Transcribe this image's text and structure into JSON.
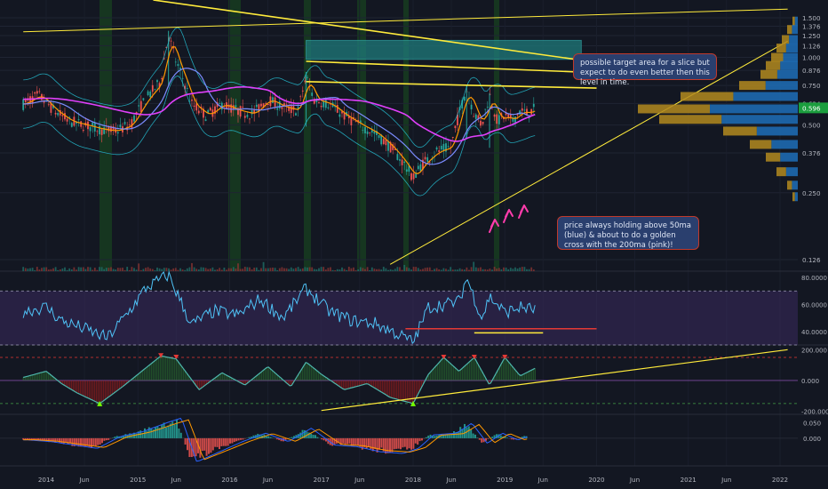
{
  "annotations": {
    "target": "possible target area for a slice but expect to do even better then this level in time.",
    "ma": "price always holding above 50ma (blue) & about to do a golden cross with the 200ma (pink)!"
  },
  "colors": {
    "background": "#131722",
    "candle_up": "#26a69a",
    "candle_down": "#ef5350",
    "ma50": "#7b8cff",
    "ma200": "#e040fb",
    "ema": "#ff9800",
    "bollinger": "#26c6da",
    "trendline": "#ffeb3b",
    "rsi": "#4fc3f7",
    "price_badge": "#1b9e3e",
    "arrow": "#ff3cac"
  },
  "chart_data": [
    {
      "type": "candlestick",
      "panel": "price",
      "y_scale": "log",
      "ylim": [
        0.11,
        1.62
      ],
      "x_range": [
        "2013-10",
        "2022-02"
      ],
      "last_price": "0.596",
      "x_ticks": [
        "2014",
        "Jun",
        "2015",
        "Jun",
        "2016",
        "Jun",
        "2017",
        "Jun",
        "2018",
        "Jun",
        "2019",
        "Jun",
        "2020",
        "Jun",
        "2021",
        "Jun",
        "2022"
      ],
      "y_ticks": [
        "1.500",
        "1.376",
        "1.250",
        "1.126",
        "1.000",
        "0.876",
        "0.750",
        "0.624",
        "0.500",
        "0.376",
        "0.250",
        "0.126"
      ],
      "close": [
        [
          "2013-10",
          0.62
        ],
        [
          "2013-12",
          0.68
        ],
        [
          "2014-02",
          0.58
        ],
        [
          "2014-04",
          0.52
        ],
        [
          "2014-06",
          0.5
        ],
        [
          "2014-08",
          0.48
        ],
        [
          "2014-10",
          0.47
        ],
        [
          "2014-12",
          0.5
        ],
        [
          "2015-02",
          0.65
        ],
        [
          "2015-04",
          0.78
        ],
        [
          "2015-05",
          1.25
        ],
        [
          "2015-06",
          0.95
        ],
        [
          "2015-08",
          0.62
        ],
        [
          "2015-10",
          0.55
        ],
        [
          "2015-12",
          0.62
        ],
        [
          "2016-02",
          0.58
        ],
        [
          "2016-04",
          0.56
        ],
        [
          "2016-06",
          0.65
        ],
        [
          "2016-08",
          0.6
        ],
        [
          "2016-10",
          0.58
        ],
        [
          "2016-11",
          0.82
        ],
        [
          "2016-12",
          0.65
        ],
        [
          "2017-02",
          0.62
        ],
        [
          "2017-04",
          0.55
        ],
        [
          "2017-06",
          0.5
        ],
        [
          "2017-08",
          0.46
        ],
        [
          "2017-10",
          0.4
        ],
        [
          "2017-12",
          0.33
        ],
        [
          "2018-01",
          0.29
        ],
        [
          "2018-02",
          0.33
        ],
        [
          "2018-04",
          0.38
        ],
        [
          "2018-06",
          0.4
        ],
        [
          "2018-08",
          0.72
        ],
        [
          "2018-09",
          0.56
        ],
        [
          "2018-10",
          0.5
        ],
        [
          "2018-11",
          0.68
        ],
        [
          "2018-12",
          0.52
        ],
        [
          "2019-01",
          0.55
        ],
        [
          "2019-02",
          0.52
        ],
        [
          "2019-03",
          0.58
        ],
        [
          "2019-04",
          0.56
        ],
        [
          "2019-05",
          0.596
        ]
      ],
      "volume_profile": [
        {
          "price": 1.45,
          "size": 1
        },
        {
          "price": 1.33,
          "size": 2
        },
        {
          "price": 1.2,
          "size": 3
        },
        {
          "price": 1.1,
          "size": 4
        },
        {
          "price": 1.0,
          "size": 5
        },
        {
          "price": 0.92,
          "size": 6
        },
        {
          "price": 0.84,
          "size": 7
        },
        {
          "price": 0.75,
          "size": 11
        },
        {
          "price": 0.67,
          "size": 22
        },
        {
          "price": 0.59,
          "size": 30
        },
        {
          "price": 0.53,
          "size": 26
        },
        {
          "price": 0.47,
          "size": 14
        },
        {
          "price": 0.41,
          "size": 9
        },
        {
          "price": 0.36,
          "size": 6
        },
        {
          "price": 0.31,
          "size": 4
        },
        {
          "price": 0.27,
          "size": 2
        },
        {
          "price": 0.24,
          "size": 1
        }
      ],
      "target_zone": {
        "from": "2016-11",
        "to": "2019-11",
        "low": 0.98,
        "high": 1.19
      },
      "trendlines": [
        {
          "from": [
            "2013-10",
            1.3
          ],
          "to": [
            "2022-02",
            1.64
          ]
        },
        {
          "from": [
            "2015-03",
            1.8
          ],
          "to": [
            "2020-02",
            0.94
          ]
        },
        {
          "from": [
            "2016-11",
            0.96
          ],
          "to": [
            "2019-11",
            0.86
          ]
        },
        {
          "from": [
            "2016-11",
            0.78
          ],
          "to": [
            "2020-01",
            0.73
          ]
        },
        {
          "from": [
            "2017-10",
            0.12
          ],
          "to": [
            "2022-02",
            1.18
          ]
        }
      ]
    },
    {
      "type": "line",
      "panel": "rsi",
      "ylim": [
        30,
        84
      ],
      "y_ticks": [
        "80.0000",
        "60.0000",
        "40.0000"
      ],
      "bands": [
        70,
        30
      ],
      "values": [
        [
          "2013-10",
          55
        ],
        [
          "2014-01",
          58
        ],
        [
          "2014-03",
          48
        ],
        [
          "2014-06",
          42
        ],
        [
          "2014-09",
          35
        ],
        [
          "2014-12",
          56
        ],
        [
          "2015-02",
          72
        ],
        [
          "2015-05",
          82
        ],
        [
          "2015-08",
          45
        ],
        [
          "2015-11",
          55
        ],
        [
          "2016-02",
          52
        ],
        [
          "2016-05",
          64
        ],
        [
          "2016-08",
          50
        ],
        [
          "2016-11",
          72
        ],
        [
          "2017-02",
          55
        ],
        [
          "2017-05",
          48
        ],
        [
          "2017-08",
          46
        ],
        [
          "2017-11",
          38
        ],
        [
          "2018-01",
          32
        ],
        [
          "2018-03",
          58
        ],
        [
          "2018-05",
          60
        ],
        [
          "2018-07",
          62
        ],
        [
          "2018-08",
          80
        ],
        [
          "2018-10",
          50
        ],
        [
          "2018-11",
          66
        ],
        [
          "2019-01",
          54
        ],
        [
          "2019-03",
          58
        ],
        [
          "2019-05",
          56
        ]
      ],
      "support": {
        "from": "2017-12",
        "to": "2020-01",
        "value": 42
      },
      "second_line": {
        "from": "2018-09",
        "to": "2019-06",
        "value": 39
      }
    },
    {
      "type": "area",
      "panel": "oscillator",
      "ylim": [
        -220,
        225
      ],
      "y_ticks": [
        "200.000",
        "0.000",
        "-200.000"
      ],
      "levels": [
        150,
        0,
        -150
      ],
      "values": [
        [
          "2013-10",
          20
        ],
        [
          "2014-01",
          60
        ],
        [
          "2014-03",
          -20
        ],
        [
          "2014-05",
          -80
        ],
        [
          "2014-08",
          -150
        ],
        [
          "2014-11",
          -40
        ],
        [
          "2015-02",
          80
        ],
        [
          "2015-04",
          160
        ],
        [
          "2015-06",
          140
        ],
        [
          "2015-09",
          -60
        ],
        [
          "2015-12",
          50
        ],
        [
          "2016-03",
          -30
        ],
        [
          "2016-06",
          90
        ],
        [
          "2016-09",
          -40
        ],
        [
          "2016-11",
          120
        ],
        [
          "2017-01",
          40
        ],
        [
          "2017-04",
          -60
        ],
        [
          "2017-07",
          -20
        ],
        [
          "2017-10",
          -110
        ],
        [
          "2018-01",
          -150
        ],
        [
          "2018-03",
          40
        ],
        [
          "2018-05",
          150
        ],
        [
          "2018-07",
          60
        ],
        [
          "2018-09",
          150
        ],
        [
          "2018-11",
          -30
        ],
        [
          "2019-01",
          150
        ],
        [
          "2019-03",
          30
        ],
        [
          "2019-05",
          80
        ]
      ],
      "trendline": {
        "from": [
          "2017-01",
          -195
        ],
        "to": [
          "2022-02",
          200
        ]
      }
    },
    {
      "type": "bar",
      "panel": "macd",
      "ylim": [
        -0.09,
        0.075
      ],
      "y_ticks": [
        "0.050",
        "0.000"
      ],
      "histogram": [
        [
          "2013-10",
          -0.005
        ],
        [
          "2014-01",
          -0.01
        ],
        [
          "2014-04",
          -0.02
        ],
        [
          "2014-07",
          -0.03
        ],
        [
          "2014-10",
          0.005
        ],
        [
          "2015-01",
          0.02
        ],
        [
          "2015-04",
          0.045
        ],
        [
          "2015-06",
          0.06
        ],
        [
          "2015-08",
          -0.07
        ],
        [
          "2015-11",
          -0.04
        ],
        [
          "2016-02",
          -0.01
        ],
        [
          "2016-05",
          0.015
        ],
        [
          "2016-08",
          -0.01
        ],
        [
          "2016-11",
          0.03
        ],
        [
          "2017-02",
          -0.02
        ],
        [
          "2017-05",
          -0.025
        ],
        [
          "2017-08",
          -0.04
        ],
        [
          "2017-11",
          -0.045
        ],
        [
          "2018-01",
          -0.03
        ],
        [
          "2018-03",
          0.01
        ],
        [
          "2018-06",
          0.015
        ],
        [
          "2018-08",
          0.045
        ],
        [
          "2018-10",
          -0.015
        ],
        [
          "2018-12",
          0.015
        ],
        [
          "2019-02",
          -0.005
        ],
        [
          "2019-04",
          0.01
        ]
      ]
    }
  ]
}
